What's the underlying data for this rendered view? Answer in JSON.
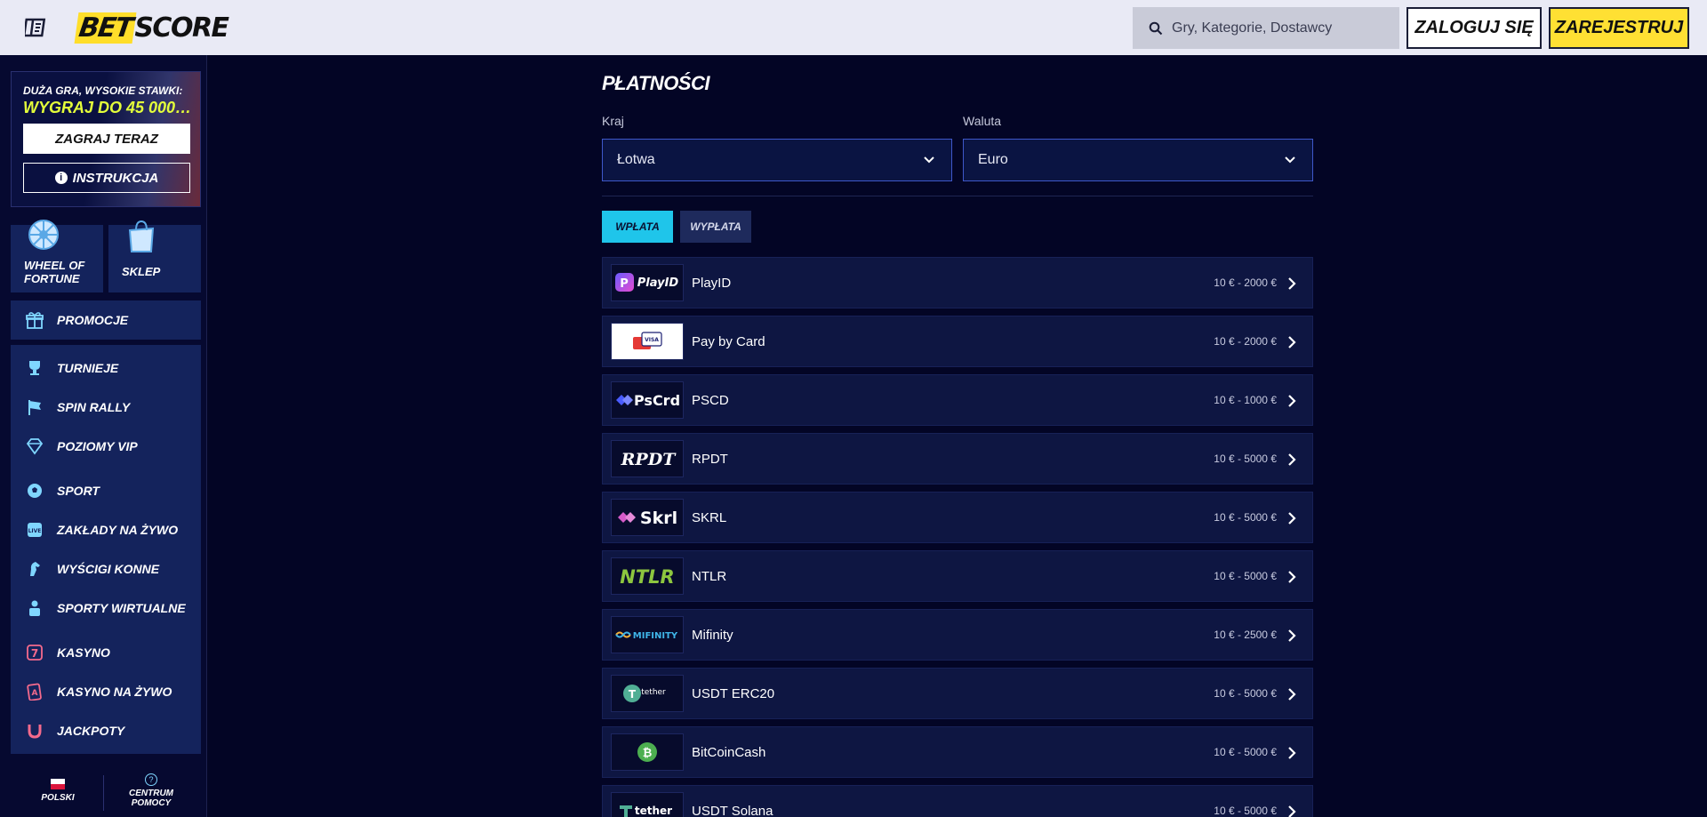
{
  "header": {
    "brand_part1": "BET",
    "brand_part2": "SCORE",
    "search_placeholder": "Gry, Kategorie, Dostawcy",
    "login_label": "ZALOGUJ SIĘ",
    "register_label": "ZAREJESTRUJ"
  },
  "sidebar": {
    "promo": {
      "line1": "DUŻA GRA, WYSOKIE STAWKI:",
      "line2": "WYGRAJ DO 45 000 ...",
      "play_label": "ZAGRAJ TERAZ",
      "instructions_label": "INSTRUKCJA"
    },
    "tiles": [
      {
        "label": "WHEEL OF FORTUNE",
        "icon": "wheel-icon"
      },
      {
        "label": "SKLEP",
        "icon": "shopping-bag-icon"
      }
    ],
    "items": [
      {
        "label": "PROMOCJE",
        "icon": "gift-icon"
      },
      {
        "label": "TURNIEJE",
        "icon": "trophy-icon"
      },
      {
        "label": "SPIN RALLY",
        "icon": "flag-icon"
      },
      {
        "label": "POZIOMY VIP",
        "icon": "diamond-icon"
      },
      {
        "label": "SPORT",
        "icon": "soccer-ball-icon"
      },
      {
        "label": "ZAKŁADY NA ŻYWO",
        "icon": "live-icon"
      },
      {
        "label": "WYŚCIGI KONNE",
        "icon": "horse-icon"
      },
      {
        "label": "SPORTY WIRTUALNE",
        "icon": "virtual-sport-icon"
      },
      {
        "label": "KASYNO",
        "icon": "slot-seven-icon"
      },
      {
        "label": "KASYNO NA ŻYWO",
        "icon": "card-icon"
      },
      {
        "label": "JACKPOTY",
        "icon": "horseshoe-icon"
      }
    ],
    "footer": {
      "language_label": "POLSKI",
      "help_line1": "CENTRUM",
      "help_line2": "POMOCY"
    }
  },
  "main": {
    "title": "PŁATNOŚCI",
    "country_label": "Kraj",
    "country_value": "Łotwa",
    "currency_label": "Waluta",
    "currency_value": "Euro",
    "tabs": [
      {
        "label": "WPŁATA",
        "active": true
      },
      {
        "label": "WYPŁATA",
        "active": false
      }
    ],
    "methods": [
      {
        "name": "PlayID",
        "range": "10 € - 2000 €",
        "logo_text": "PlayID",
        "logo_color": "#ffffff"
      },
      {
        "name": "Pay by Card",
        "range": "10 € - 2000 €",
        "logo_text": "VISA",
        "logo_color": "#1a1f71"
      },
      {
        "name": "PSCD",
        "range": "10 € - 1000 €",
        "logo_text": "PsCrd",
        "logo_color": "#ffffff"
      },
      {
        "name": "RPDT",
        "range": "10 € - 5000 €",
        "logo_text": "RPDT",
        "logo_color": "#ffffff"
      },
      {
        "name": "SKRL",
        "range": "10 € - 5000 €",
        "logo_text": "Skrl",
        "logo_color": "#ffffff"
      },
      {
        "name": "NTLR",
        "range": "10 € - 5000 €",
        "logo_text": "NTLR",
        "logo_color": "#8dc63f"
      },
      {
        "name": "Mifinity",
        "range": "10 € - 2500 €",
        "logo_text": "MIFINITY",
        "logo_color": "#3fb5e8"
      },
      {
        "name": "USDT ERC20",
        "range": "10 € - 5000 €",
        "logo_text": "tether",
        "logo_color": "#ffffff"
      },
      {
        "name": "BitCoinCash",
        "range": "10 € - 5000 €",
        "logo_text": "₿",
        "logo_color": "#ffffff"
      },
      {
        "name": "USDT Solana",
        "range": "10 € - 5000 €",
        "logo_text": "tether",
        "logo_color": "#ffffff"
      }
    ]
  }
}
